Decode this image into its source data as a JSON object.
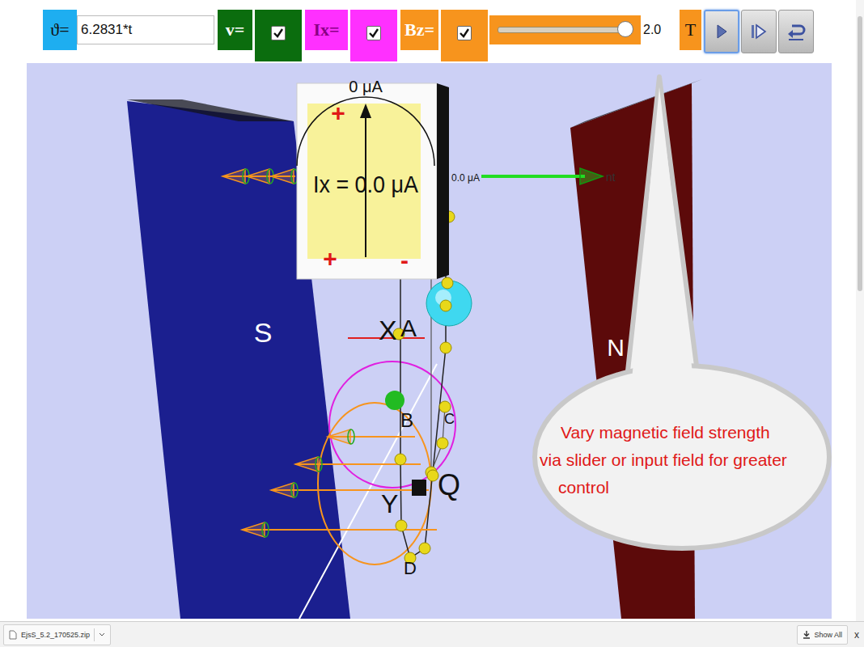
{
  "toolbar": {
    "angle": {
      "label": "ϑ=",
      "value": "6.2831*t"
    },
    "toggles": [
      {
        "label": "v=",
        "checked": true,
        "color": "#0b6d0e"
      },
      {
        "label": "Ix=",
        "checked": true,
        "color": "#ff30ff"
      },
      {
        "label": "Bz=",
        "checked": true,
        "color": "#f7941d"
      }
    ],
    "field": {
      "level": 0.95,
      "value": "2.0",
      "unit": "T"
    },
    "buttons": [
      {
        "kind": "play",
        "selected": true
      },
      {
        "kind": "step",
        "selected": false
      },
      {
        "kind": "reset",
        "selected": false
      }
    ]
  },
  "scene": {
    "magnets": [
      {
        "label": "S",
        "color": "#1b1f8f"
      },
      {
        "label": "N",
        "color": "#5c0a0a"
      }
    ],
    "meter": {
      "scale_top": "0 μA",
      "reading": "Ix = 0.0 μA",
      "scale_right": "0.0 μA",
      "plus_marks": [
        "+",
        "+"
      ],
      "minus_mark": "-"
    },
    "arrow_label": "nt",
    "points": [
      "X",
      "A",
      "B",
      "C",
      "Y",
      "Q",
      "D"
    ],
    "callout": {
      "lines": [
        "Vary magnetic field strength",
        "via slider or input field for greater",
        "control"
      ]
    }
  },
  "downloads": {
    "file": "EjsS_5.2_170525.zip",
    "show_all": "Show All",
    "close": "x"
  }
}
